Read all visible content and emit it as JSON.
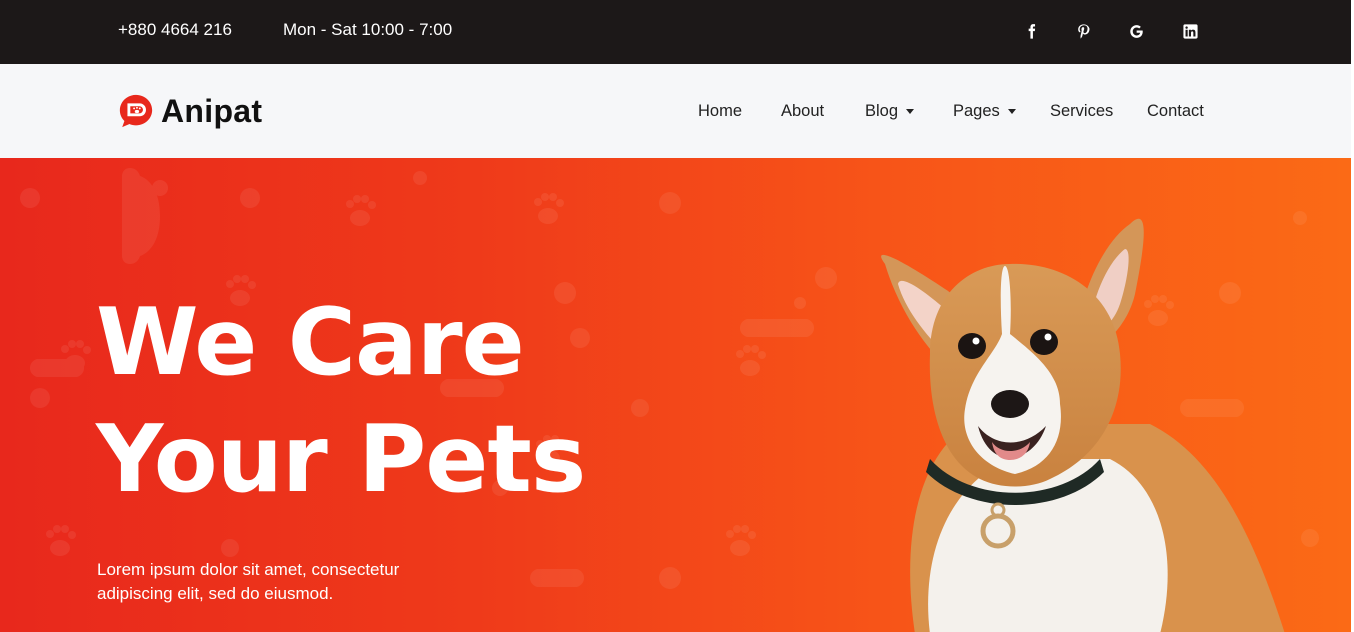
{
  "topbar": {
    "phone": "+880 4664 216",
    "hours": "Mon - Sat 10:00 - 7:00",
    "social": [
      "facebook-icon",
      "pinterest-icon",
      "google-icon",
      "linkedin-icon"
    ]
  },
  "navbar": {
    "brand": "Anipat",
    "items": [
      {
        "label": "Home",
        "dropdown": false
      },
      {
        "label": "About",
        "dropdown": false
      },
      {
        "label": "Blog",
        "dropdown": true
      },
      {
        "label": "Pages",
        "dropdown": true
      },
      {
        "label": "Services",
        "dropdown": false
      },
      {
        "label": "Contact",
        "dropdown": false
      }
    ]
  },
  "hero": {
    "title_line1": "We Care",
    "title_line2": "Your Pets",
    "description": "Lorem ipsum dolor sit amet, consectetur adipiscing elit, sed do eiusmod."
  },
  "colors": {
    "topbar_bg": "#1c1818",
    "navbar_bg": "#f6f7f9",
    "brand_red": "#e8281c",
    "hero_orange": "#fb6a16"
  }
}
